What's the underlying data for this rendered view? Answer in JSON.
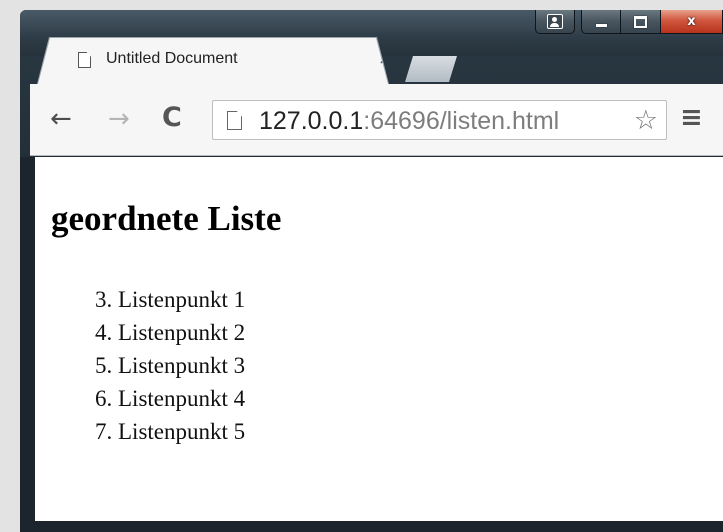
{
  "window": {
    "caption_close": "x"
  },
  "tab": {
    "title": "Untitled Document",
    "close_glyph": "×"
  },
  "toolbar": {
    "back_glyph": "←",
    "forward_glyph": "→",
    "reload_glyph": "C",
    "url_host": "127.0.0.1",
    "url_rest": ":64696/listen.html",
    "star_glyph": "☆",
    "menu_glyph": "≡"
  },
  "page": {
    "heading": "geordnete Liste",
    "list_items": [
      "3. Listenpunkt 1",
      "4. Listenpunkt 2",
      "5. Listenpunkt 3",
      "6. Listenpunkt 4",
      "7. Listenpunkt 5"
    ]
  },
  "icons": {
    "tab_favicon": "page-icon",
    "omnibox_icon": "page-icon",
    "caption_user": "user-icon",
    "caption_minimize": "minimize-icon",
    "caption_maximize": "maximize-icon",
    "caption_close": "close-icon"
  }
}
